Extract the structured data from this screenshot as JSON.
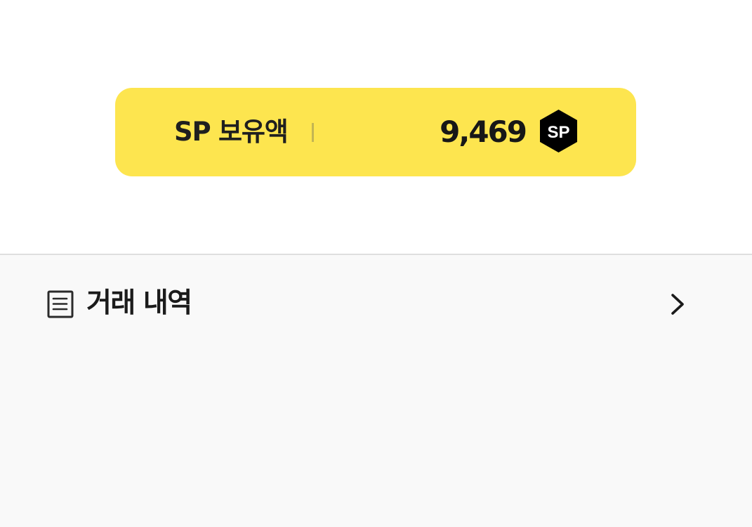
{
  "balance_card": {
    "label": "SP 보유액",
    "value": "9,469",
    "badge": {
      "icon": "sp-coin-icon",
      "text": "SP"
    },
    "colors": {
      "background": "#fde54f",
      "text": "#1f1f1f",
      "badge": "#000000"
    }
  },
  "transaction_history": {
    "label": "거래 내역",
    "icons": {
      "leading": "document-list-icon",
      "trailing": "chevron-right-icon"
    }
  },
  "colors": {
    "top_background": "#ffffff",
    "bottom_background": "#f9f9f9",
    "divider": "#dedede"
  }
}
